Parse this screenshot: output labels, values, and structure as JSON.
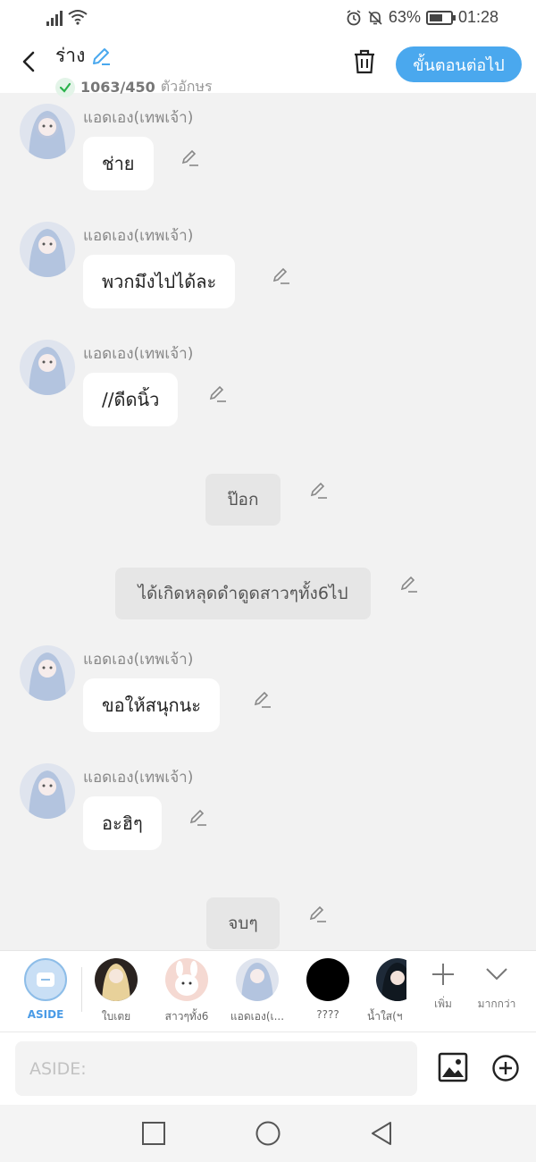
{
  "status_bar": {
    "battery_percent": "63%",
    "time": "01:28"
  },
  "header": {
    "title": "ร่าง",
    "char_count": "1063/450",
    "char_unit": "ตัวอักษร",
    "next_label": "ขั้นตอนต่อไป"
  },
  "messages": [
    {
      "type": "chat",
      "sender": "แอดเอง(เทพเจ้า)",
      "text": "ช่าย"
    },
    {
      "type": "chat",
      "sender": "แอดเอง(เทพเจ้า)",
      "text": "พวกมึงไปได้ละ"
    },
    {
      "type": "chat",
      "sender": "แอดเอง(เทพเจ้า)",
      "text": "//ดีดนิ้ว"
    },
    {
      "type": "narration",
      "text": "ป๊อก"
    },
    {
      "type": "narration",
      "text": "ได้เกิดหลุดดำดูดสาวๆทั้ง6ไป"
    },
    {
      "type": "chat",
      "sender": "แอดเอง(เทพเจ้า)",
      "text": "ขอให้สนุกนะ"
    },
    {
      "type": "chat",
      "sender": "แอดเอง(เทพเจ้า)",
      "text": "อะฮิๆ"
    },
    {
      "type": "narration",
      "text": "จบๆ"
    }
  ],
  "characters": [
    {
      "label": "ASIDE"
    },
    {
      "label": "ใบเตย"
    },
    {
      "label": "สาวๆทั้ง6"
    },
    {
      "label": "แอดเอง(เ..."
    },
    {
      "label": "????"
    },
    {
      "label": "น้ำใส(ฯ"
    }
  ],
  "tools": {
    "add_label": "เพิ่ม",
    "more_label": "มากกว่า"
  },
  "input": {
    "placeholder": "ASIDE:"
  },
  "colors": {
    "accent": "#4aa8ee",
    "background": "#f2f2f2",
    "narration_bg": "#e6e6e6"
  }
}
